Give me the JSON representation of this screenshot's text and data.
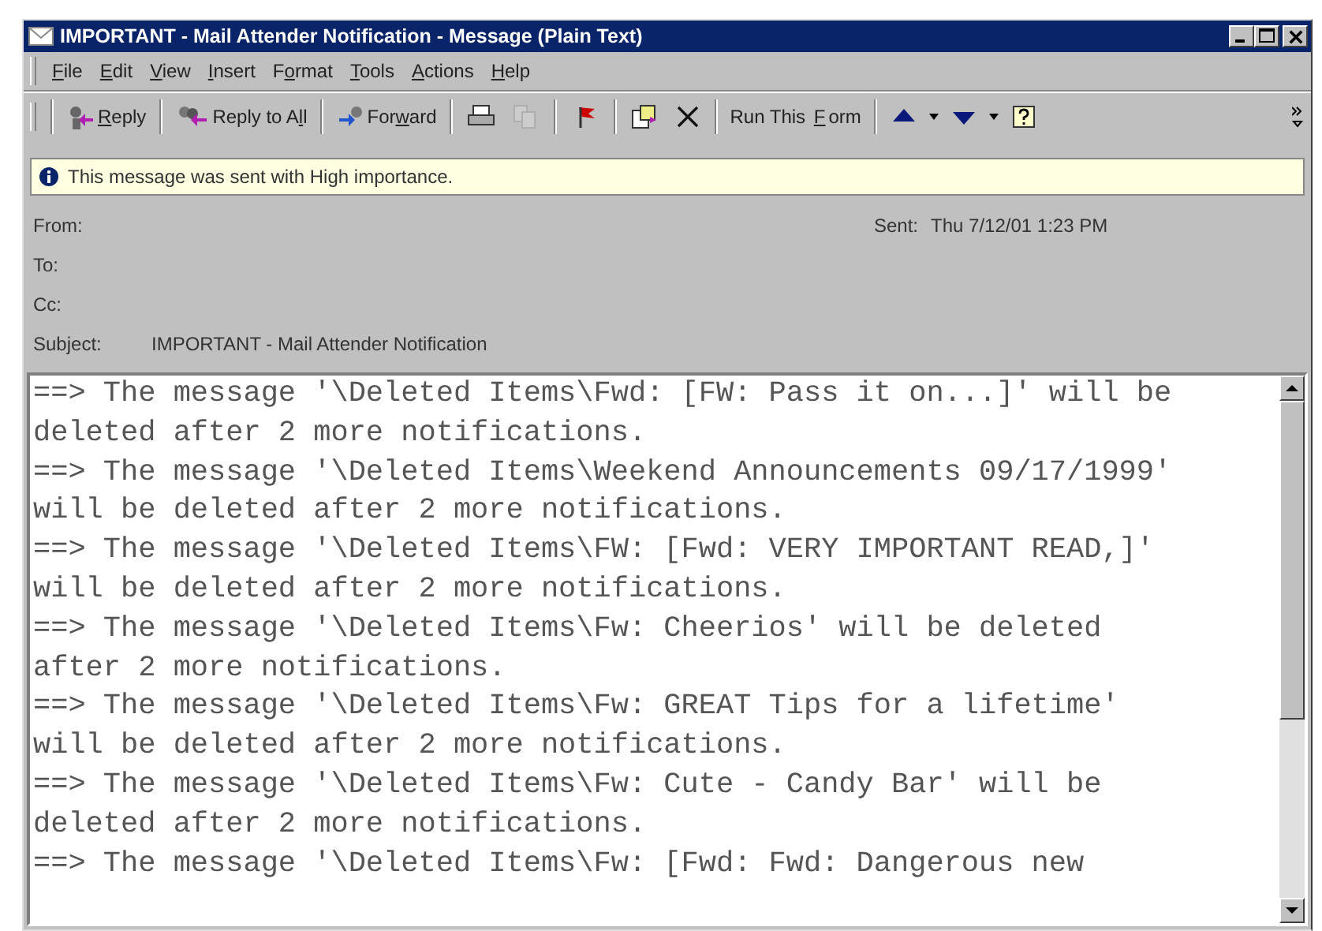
{
  "window": {
    "title": "IMPORTANT - Mail Attender Notification - Message (Plain Text)"
  },
  "menu": [
    {
      "key": "F",
      "after": "ile"
    },
    {
      "key": "E",
      "after": "dit"
    },
    {
      "key": "V",
      "after": "iew"
    },
    {
      "key": "I",
      "after": "nsert"
    },
    {
      "before": "F",
      "key": "o",
      "after": "rmat"
    },
    {
      "key": "T",
      "after": "ools"
    },
    {
      "key": "A",
      "after": "ctions"
    },
    {
      "key": "H",
      "after": "elp"
    }
  ],
  "toolbar": [
    {
      "kind": "reply",
      "key": "R",
      "after": "eply",
      "disabled": false
    },
    {
      "kind": "reply-all",
      "before": "Reply to A",
      "key": "l",
      "after": "l",
      "disabled": false
    },
    {
      "kind": "forward",
      "before": "For",
      "key": "w",
      "after": "ard",
      "disabled": false
    },
    {
      "kind": "print",
      "disabled": false
    },
    {
      "kind": "copy",
      "disabled": true
    },
    {
      "kind": "flag",
      "disabled": false
    },
    {
      "kind": "move",
      "disabled": false
    },
    {
      "kind": "delete",
      "disabled": false
    },
    {
      "kind": "text",
      "before": "Run This ",
      "key": "F",
      "after": "orm",
      "disabled": false
    },
    {
      "kind": "up",
      "disabled": false
    },
    {
      "kind": "dropdown",
      "disabled": false
    },
    {
      "kind": "down",
      "disabled": false
    },
    {
      "kind": "dropdown",
      "disabled": false
    },
    {
      "kind": "help",
      "disabled": false
    }
  ],
  "info_bar": {
    "text": "This message was sent with High importance."
  },
  "header": {
    "from_label": "From:",
    "sent_label": "Sent:",
    "sent": "Thu 7/12/01 1:23 PM",
    "to_label": "To:",
    "cc_label": "Cc:",
    "subject_label": "Subject:",
    "subject": "IMPORTANT - Mail Attender Notification"
  },
  "body": {
    "lines": [
      "==> The message '\\Deleted Items\\Fwd: [FW: Pass it on...]' will be",
      "deleted after 2 more notifications.",
      "==> The message '\\Deleted Items\\Weekend Announcements 09/17/1999'",
      "will be deleted after 2 more notifications.",
      "==> The message '\\Deleted Items\\FW: [Fwd: VERY IMPORTANT READ,]'",
      "will be deleted after 2 more notifications.",
      "==> The message '\\Deleted Items\\Fw: Cheerios' will be deleted",
      "after 2 more notifications.",
      "==> The message '\\Deleted Items\\Fw: GREAT Tips for a lifetime'",
      "will be deleted after 2 more notifications.",
      "==> The message '\\Deleted Items\\Fw: Cute - Candy Bar' will be",
      "deleted after 2 more notifications.",
      "==> The message '\\Deleted Items\\Fw: [Fwd: Fwd: Dangerous new"
    ]
  }
}
